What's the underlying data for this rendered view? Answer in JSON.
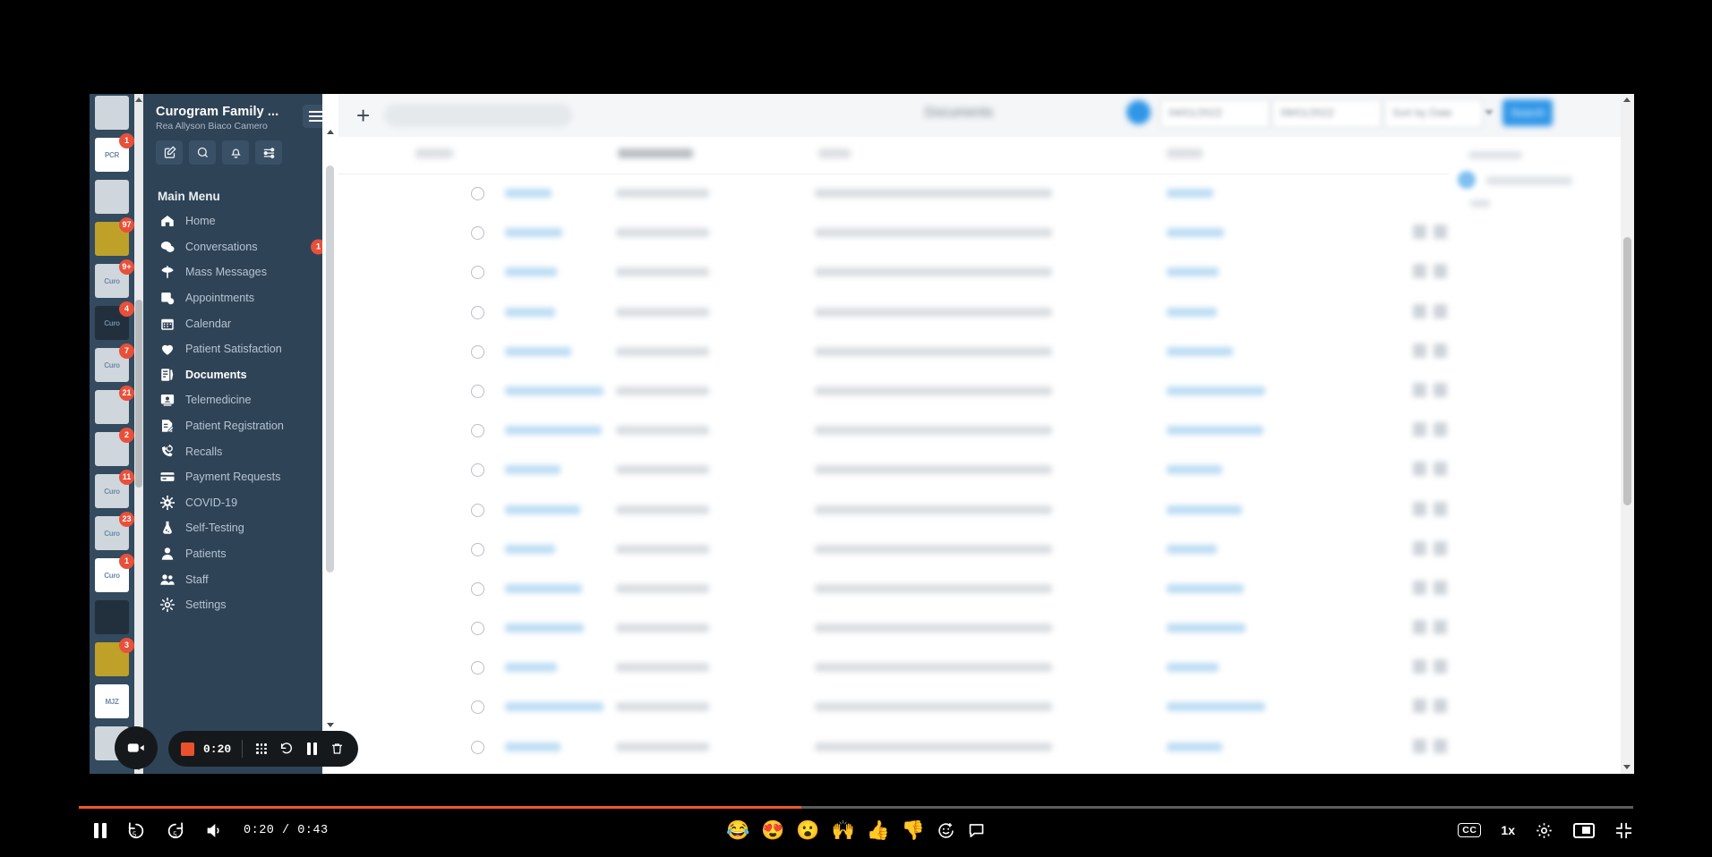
{
  "sidebar": {
    "org_title": "Curogram Family ...",
    "user_name": "Rea Allyson Biaco Camero",
    "menu_label": "Main Menu",
    "tools": [
      {
        "name": "compose-icon"
      },
      {
        "name": "search-icon"
      },
      {
        "name": "bell-icon"
      },
      {
        "name": "sliders-icon"
      }
    ],
    "items": [
      {
        "label": "Home",
        "icon": "home-icon",
        "badge": "",
        "active": false
      },
      {
        "label": "Conversations",
        "icon": "chat-icon",
        "badge": "1",
        "active": false
      },
      {
        "label": "Mass Messages",
        "icon": "megaphone-icon",
        "badge": "",
        "active": false
      },
      {
        "label": "Appointments",
        "icon": "appointments-icon",
        "badge": "",
        "active": false
      },
      {
        "label": "Calendar",
        "icon": "calendar-icon",
        "badge": "",
        "active": false
      },
      {
        "label": "Patient Satisfaction",
        "icon": "heart-icon",
        "badge": "",
        "active": false
      },
      {
        "label": "Documents",
        "icon": "documents-icon",
        "badge": "",
        "active": true
      },
      {
        "label": "Telemedicine",
        "icon": "video-card-icon",
        "badge": "",
        "active": false
      },
      {
        "label": "Patient Registration",
        "icon": "form-icon",
        "badge": "",
        "active": false
      },
      {
        "label": "Recalls",
        "icon": "phone-refresh-icon",
        "badge": "",
        "active": false
      },
      {
        "label": "Payment Requests",
        "icon": "credit-card-icon",
        "badge": "",
        "active": false
      },
      {
        "label": "COVID-19",
        "icon": "virus-icon",
        "badge": "",
        "active": false
      },
      {
        "label": "Self-Testing",
        "icon": "flask-icon",
        "badge": "",
        "active": false
      },
      {
        "label": "Patients",
        "icon": "person-icon",
        "badge": "",
        "active": false
      },
      {
        "label": "Staff",
        "icon": "people-icon",
        "badge": "",
        "active": false
      },
      {
        "label": "Settings",
        "icon": "gear-icon",
        "badge": "",
        "active": false
      }
    ]
  },
  "app_rail": {
    "items": [
      {
        "label": "",
        "badge": "",
        "style": "t-blue"
      },
      {
        "label": "PCR",
        "badge": "1",
        "style": "t-white"
      },
      {
        "label": "",
        "badge": "",
        "style": "t-blue"
      },
      {
        "label": "",
        "badge": "97",
        "style": "t-gold"
      },
      {
        "label": "Curo",
        "badge": "9+",
        "style": "t-blue"
      },
      {
        "label": "Curo",
        "badge": "4",
        "style": "t-dark"
      },
      {
        "label": "Curo",
        "badge": "7",
        "style": "t-blue"
      },
      {
        "label": "",
        "badge": "21",
        "style": "t-blue"
      },
      {
        "label": "",
        "badge": "2",
        "style": "t-blue"
      },
      {
        "label": "Curo",
        "badge": "11",
        "style": "t-blue"
      },
      {
        "label": "Curo",
        "badge": "23",
        "style": "t-blue"
      },
      {
        "label": "Curo",
        "badge": "1",
        "style": "t-white"
      },
      {
        "label": "",
        "badge": "",
        "style": "t-dark"
      },
      {
        "label": "",
        "badge": "3",
        "style": "t-gold"
      },
      {
        "label": "MJZ",
        "badge": "",
        "style": "t-white"
      },
      {
        "label": "",
        "badge": "",
        "style": "t-blue"
      }
    ]
  },
  "main": {
    "new_tab_label": "+",
    "omnibox_placeholder": "",
    "page_title": "Documents",
    "date_from": "04/01/2022",
    "date_to": "09/01/2022",
    "sort_label": "Sort by Date",
    "search_label": "Search",
    "columns": [
      "Name",
      "Attached On",
      "Type",
      "Action"
    ],
    "row_count": 16
  },
  "recorder": {
    "elapsed": "0:20",
    "stop_label": "stop-recording",
    "controls": [
      "drag-handle",
      "restart",
      "pause",
      "delete"
    ]
  },
  "player": {
    "current_time": "0:20",
    "total_time": "0:43",
    "time_label": "0:20 / 0:43",
    "progress_percent": 46.5,
    "speed_label": "1x",
    "cc_label": "CC",
    "reactions": [
      "😂",
      "😍",
      "😮",
      "🙌",
      "👍",
      "👎"
    ],
    "accent_color": "#f0562d"
  }
}
